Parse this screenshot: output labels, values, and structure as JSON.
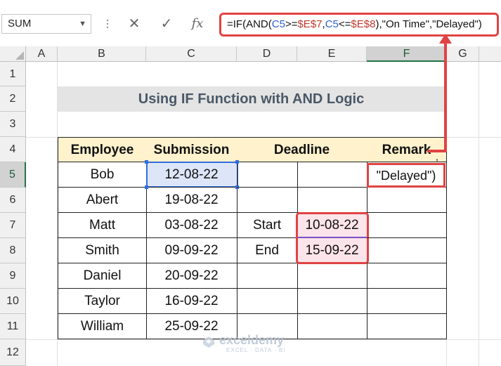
{
  "formula_bar": {
    "name_box": "SUM",
    "cancel_glyph": "✕",
    "enter_glyph": "✓",
    "fx_glyph": "fx",
    "formula_parts": [
      "=IF(AND(",
      "C5",
      ">=",
      "$E$7",
      ",",
      "C5",
      "<=",
      "$E$8",
      "),\"On Time\",\"Delayed\")"
    ]
  },
  "columns": [
    "A",
    "B",
    "C",
    "D",
    "E",
    "F",
    "G"
  ],
  "rows": [
    "1",
    "2",
    "3",
    "4",
    "5",
    "6",
    "7",
    "8",
    "9",
    "10",
    "11",
    "12"
  ],
  "title": "Using IF Function with AND Logic",
  "table": {
    "headers": {
      "employee": "Employee",
      "submission": "Submission",
      "deadline": "Deadline",
      "remark": "Remark"
    },
    "employees": [
      "Bob",
      "Abert",
      "Matt",
      "Smith",
      "Daniel",
      "Taylor",
      "William"
    ],
    "submissions": [
      "12-08-22",
      "19-08-22",
      "03-08-22",
      "09-09-22",
      "20-09-22",
      "16-09-22",
      "25-09-22"
    ],
    "deadline_labels": {
      "start": "Start",
      "end": "End"
    },
    "deadline_values": {
      "start": "10-08-22",
      "end": "15-09-22"
    },
    "remark_edit_text": "\"Delayed\")",
    "remark_overflow_char": ","
  },
  "watermark": {
    "name": "exceldemy",
    "tagline": "EXCEL · DATA · BI"
  },
  "colors": {
    "header_fill": "#fff2cc",
    "accent_red": "#e04343",
    "selection_blue": "#2f6ee0",
    "excel_green": "#217346"
  }
}
